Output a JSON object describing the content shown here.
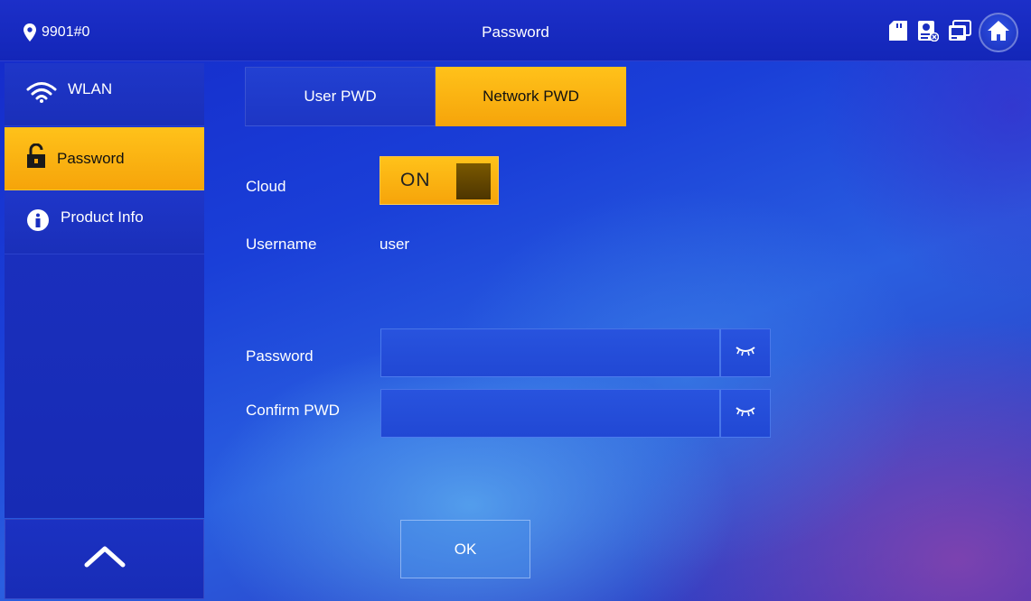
{
  "titlebar": {
    "room": "9901#0",
    "title": "Password",
    "icons": [
      "sd-card-icon",
      "camera-status-icon",
      "device-status-icon",
      "home-icon"
    ]
  },
  "sidebar": {
    "items": [
      {
        "label": "WLAN",
        "icon": "wifi-icon"
      },
      {
        "label": "Password",
        "icon": "lock-icon",
        "active": true
      },
      {
        "label": "Product Info",
        "icon": "info-icon"
      }
    ],
    "scroll_up_icon": "chevron-up-icon"
  },
  "tabs": [
    {
      "label": "User PWD",
      "active": false
    },
    {
      "label": "Network PWD",
      "active": true
    }
  ],
  "form": {
    "cloud_label": "Cloud",
    "cloud_toggle": "ON",
    "username_label": "Username",
    "username_value": "user",
    "password_label": "Password",
    "password_value": "",
    "confirm_label": "Confirm PWD",
    "confirm_value": "",
    "ok_label": "OK"
  },
  "colors": {
    "accent": "#f6a40a",
    "background": "#1a3fd8"
  }
}
